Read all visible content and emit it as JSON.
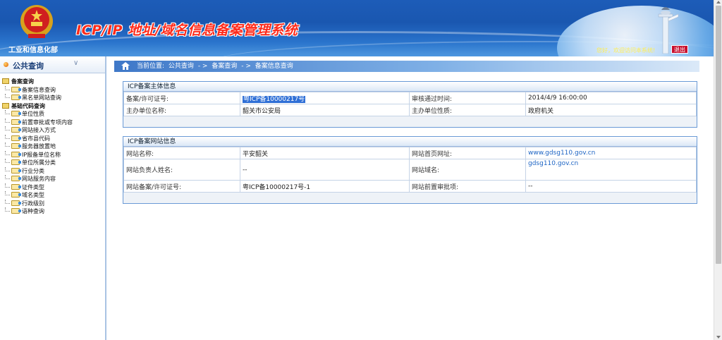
{
  "header": {
    "ministry_name": "工业和信息化部",
    "system_title": "ICP/IP 地址/域名信息备案管理系统",
    "welcome_text": "您好，欢迎访问本系统!",
    "logout_label": "退出"
  },
  "sidebar": {
    "title": "公共查询",
    "groups": [
      {
        "label": "备案查询",
        "items": [
          "备案信息查询",
          "黑名单网站查询"
        ]
      },
      {
        "label": "基础代码查询",
        "items": [
          "单位性质",
          "前置审批或专项内容",
          "网站接入方式",
          "省市县代码",
          "服务器放置地",
          "IP报备单位名称",
          "单位所属分类",
          "行业分类",
          "网站服务内容",
          "证件类型",
          "域名类型",
          "行政级别",
          "语种查询"
        ]
      }
    ]
  },
  "breadcrumb": {
    "prefix": "当前位置:",
    "level1": "公共查询",
    "sep1": "- >",
    "level2": "备案查询",
    "sep2": "- >",
    "level3": "备案信息查询"
  },
  "subject_panel": {
    "title": "ICP备案主体信息",
    "license_label": "备案/许可证号:",
    "license_value": "粤ICP备10000217号",
    "approve_time_label": "审核通过时间:",
    "approve_time_value": "2014/4/9 16:00:00",
    "org_name_label": "主办单位名称:",
    "org_name_value": "韶关市公安局",
    "org_type_label": "主办单位性质:",
    "org_type_value": "政府机关"
  },
  "site_panel": {
    "title": "ICP备案网站信息",
    "site_name_label": "网站名称:",
    "site_name_value": "平安韶关",
    "homepage_label": "网站首页网址:",
    "homepage_value": "www.gdsg110.gov.cn",
    "owner_label": "网站负责人姓名:",
    "owner_value": "--",
    "domain_label": "网站域名:",
    "domain_value": "gdsg110.gov.cn",
    "site_license_label": "网站备案/许可证号:",
    "site_license_value": "粤ICP备10000217号-1",
    "pre_approval_label": "网站前置审批项:",
    "pre_approval_value": "--"
  },
  "colors": {
    "header_blue": "#1d5cb8",
    "title_red": "#ff2a1a",
    "panel_border": "#6a9ad6",
    "link_blue": "#1d64c4"
  }
}
